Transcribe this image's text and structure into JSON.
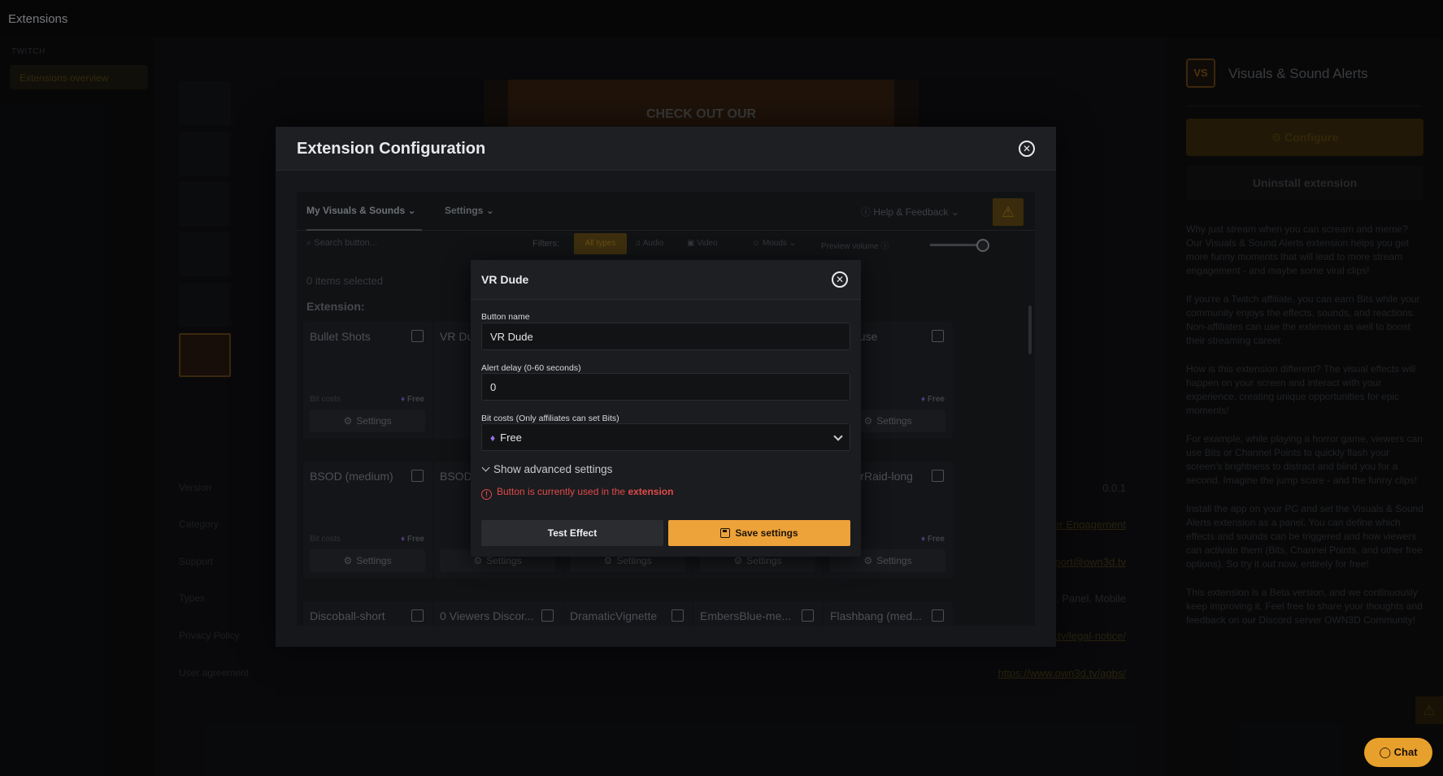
{
  "topbar": {
    "title": "Extensions"
  },
  "sidebar": {
    "section": "TWITCH",
    "items": [
      {
        "label": "Extensions overview"
      }
    ]
  },
  "banner": {
    "text": "CHECK OUT OUR"
  },
  "meta": {
    "rows": [
      {
        "label": "Version",
        "value": "0.0.1",
        "link": false
      },
      {
        "label": "Category",
        "value": "...er Engagement",
        "link": true
      },
      {
        "label": "Support",
        "value": "...pport@own3d.tv",
        "link": true
      },
      {
        "label": "Types",
        "value": "...nt, Panel, Mobile",
        "link": false
      },
      {
        "label": "Privacy Policy",
        "value": "...3d.tv/legal-notice/",
        "link": true
      },
      {
        "label": "User agreement",
        "value": "https://www.own3d.tv/agbs/",
        "link": true
      }
    ]
  },
  "right_panel": {
    "logo_text": "VS",
    "name": "Visuals & Sound Alerts",
    "configure_label": "Configure",
    "uninstall_label": "Uninstall extension",
    "paragraphs": [
      "Why just stream when you can scream and meme? Our Visuals & Sound Alerts extension helps you get more funny moments that will lead to more stream engagement - and maybe some viral clips!",
      "If you're a Twitch affiliate, you can earn Bits while your community enjoys the effects, sounds, and reactions. Non-affiliates can use the extension as well to boost their streaming career.",
      "How is this extension different? The visual effects will happen on your screen and interact with your experience, creating unique opportunities for epic moments!",
      "For example, while playing a horror game, viewers can use Bits or Channel Points to quickly flash your screen's brightness to distract and blind you for a second. Imagine the jump scare - and the funny clips!",
      "Install the app on your PC and set the Visuals & Sound Alerts extension as a panel. You can define which effects and sounds can be triggered and how viewers can activate them (Bits, Channel Points, and other free options). So try it out now, entirely for free!",
      "This extension is a Beta version, and we continuously keep improving it. Feel free to share your thoughts and feedback on our Discord server OWN3D Community!"
    ],
    "chat_label": "Chat"
  },
  "ext_modal": {
    "title": "Extension Configuration",
    "tabs": [
      {
        "label": "My Visuals & Sounds"
      },
      {
        "label": "Settings"
      }
    ],
    "help_label": "Help & Feedback",
    "search_placeholder": "Search button...",
    "filters_label": "Filters:",
    "filter_pill": "All types",
    "filter_audio": "Audio",
    "filter_video": "Video",
    "filter_moods": "Moods",
    "preview_volume": "Preview volume",
    "items_selected": "0 items selected",
    "section_label": "Extension:",
    "bit_costs_label": "Bit costs",
    "free_label": "Free",
    "settings_label": "Settings",
    "cards_row1": [
      "Bullet Shots",
      "VR Dude",
      "",
      "",
      "Applause"
    ],
    "cards_row2": [
      "BSOD (medium)",
      "BSOD",
      "",
      "",
      "CursorRaid-long"
    ],
    "cards_row3": [
      "Discoball-short",
      "0 Viewers Discor...",
      "DramaticVignette",
      "EmbersBlue-me...",
      "Flashbang (med..."
    ]
  },
  "vr_dialog": {
    "title": "VR Dude",
    "button_name_label": "Button name",
    "button_name_value": "VR Dude",
    "alert_delay_label": "Alert delay (0-60 seconds)",
    "alert_delay_value": "0",
    "bit_costs_label": "Bit costs (Only affiliates can set Bits)",
    "bit_costs_value": "Free",
    "advanced_label": "Show advanced settings",
    "error_prefix": "Button is currently used in the",
    "error_bold": "extension",
    "test_label": "Test Effect",
    "save_label": "Save settings"
  }
}
